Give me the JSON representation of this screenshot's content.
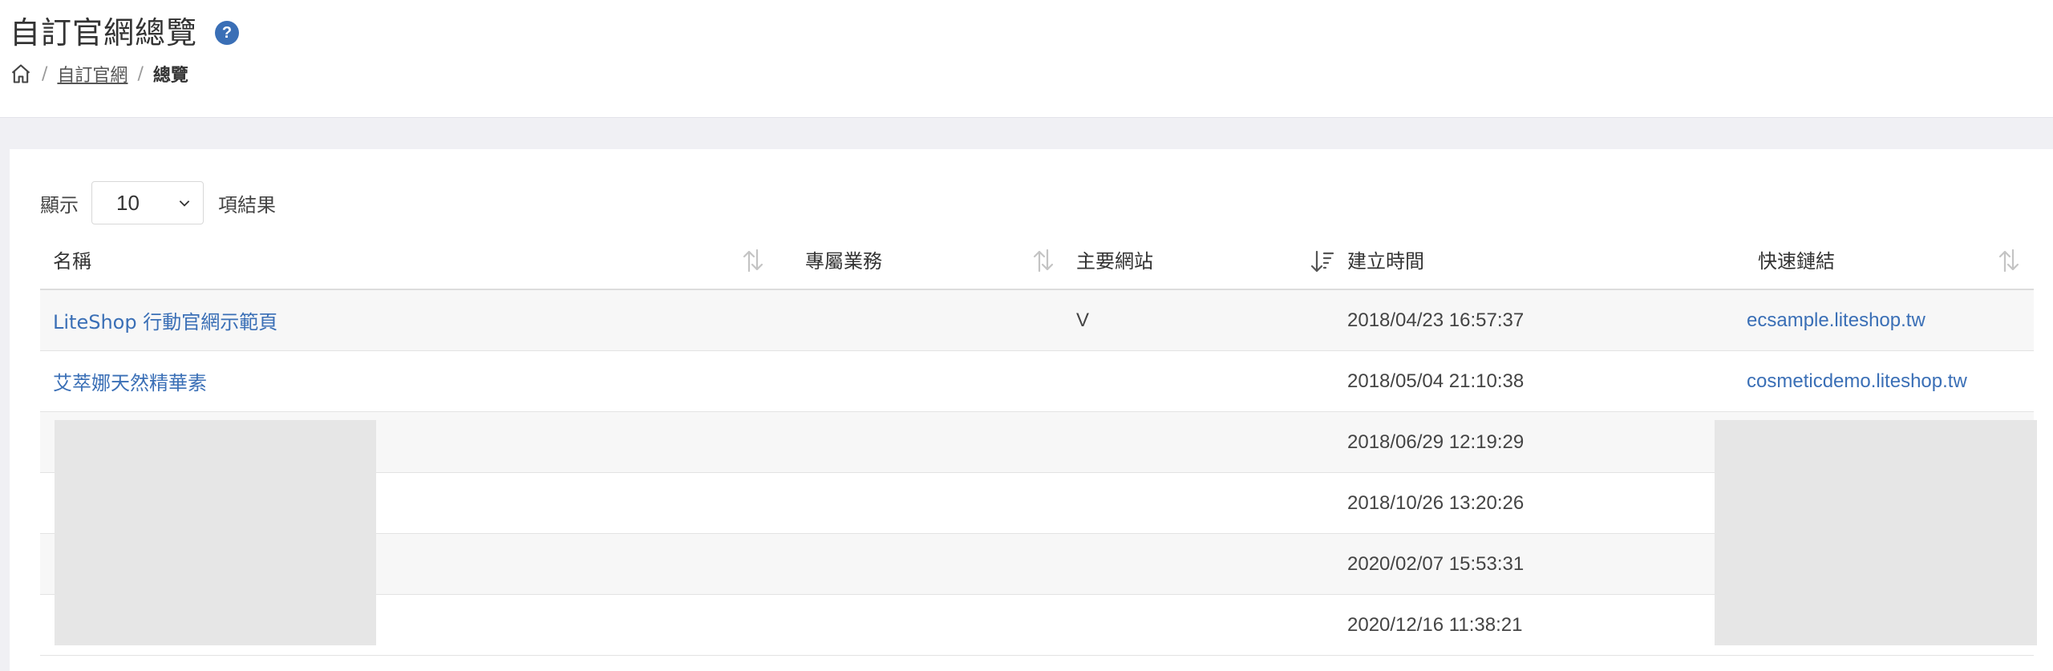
{
  "header": {
    "title": "自訂官網總覽",
    "help_label": "?",
    "breadcrumb": {
      "sep": "/",
      "parent": "自訂官網",
      "current": "總覽"
    }
  },
  "length_control": {
    "prefix": "顯示",
    "value": "10",
    "suffix": "項結果"
  },
  "table": {
    "columns": [
      {
        "label": "名稱",
        "sort": "none"
      },
      {
        "label": "專屬業務",
        "sort": "none"
      },
      {
        "label": "主要網站",
        "sort": "desc"
      },
      {
        "label": "建立時間",
        "sort": "none"
      },
      {
        "label": "快速鏈結",
        "sort": "none"
      }
    ],
    "rows": [
      {
        "name": "LiteShop 行動官網示範頁",
        "agent": "",
        "main_site": "V",
        "created": "2018/04/23 16:57:37",
        "link": "ecsample.liteshop.tw"
      },
      {
        "name": "艾萃娜天然精華素",
        "agent": "",
        "main_site": "",
        "created": "2018/05/04 21:10:38",
        "link": "cosmeticdemo.liteshop.tw"
      },
      {
        "name": "",
        "agent": "",
        "main_site": "",
        "created": "2018/06/29 12:19:29",
        "link": ""
      },
      {
        "name": "",
        "agent": "",
        "main_site": "",
        "created": "2018/10/26 13:20:26",
        "link": ""
      },
      {
        "name": "",
        "agent": "",
        "main_site": "",
        "created": "2020/02/07 15:53:31",
        "link": ""
      },
      {
        "name": "",
        "agent": "",
        "main_site": "",
        "created": "2020/12/16 11:38:21",
        "link": ""
      }
    ]
  },
  "colors": {
    "accent": "#3a6fb6",
    "redaction": "#e6e6e6"
  }
}
